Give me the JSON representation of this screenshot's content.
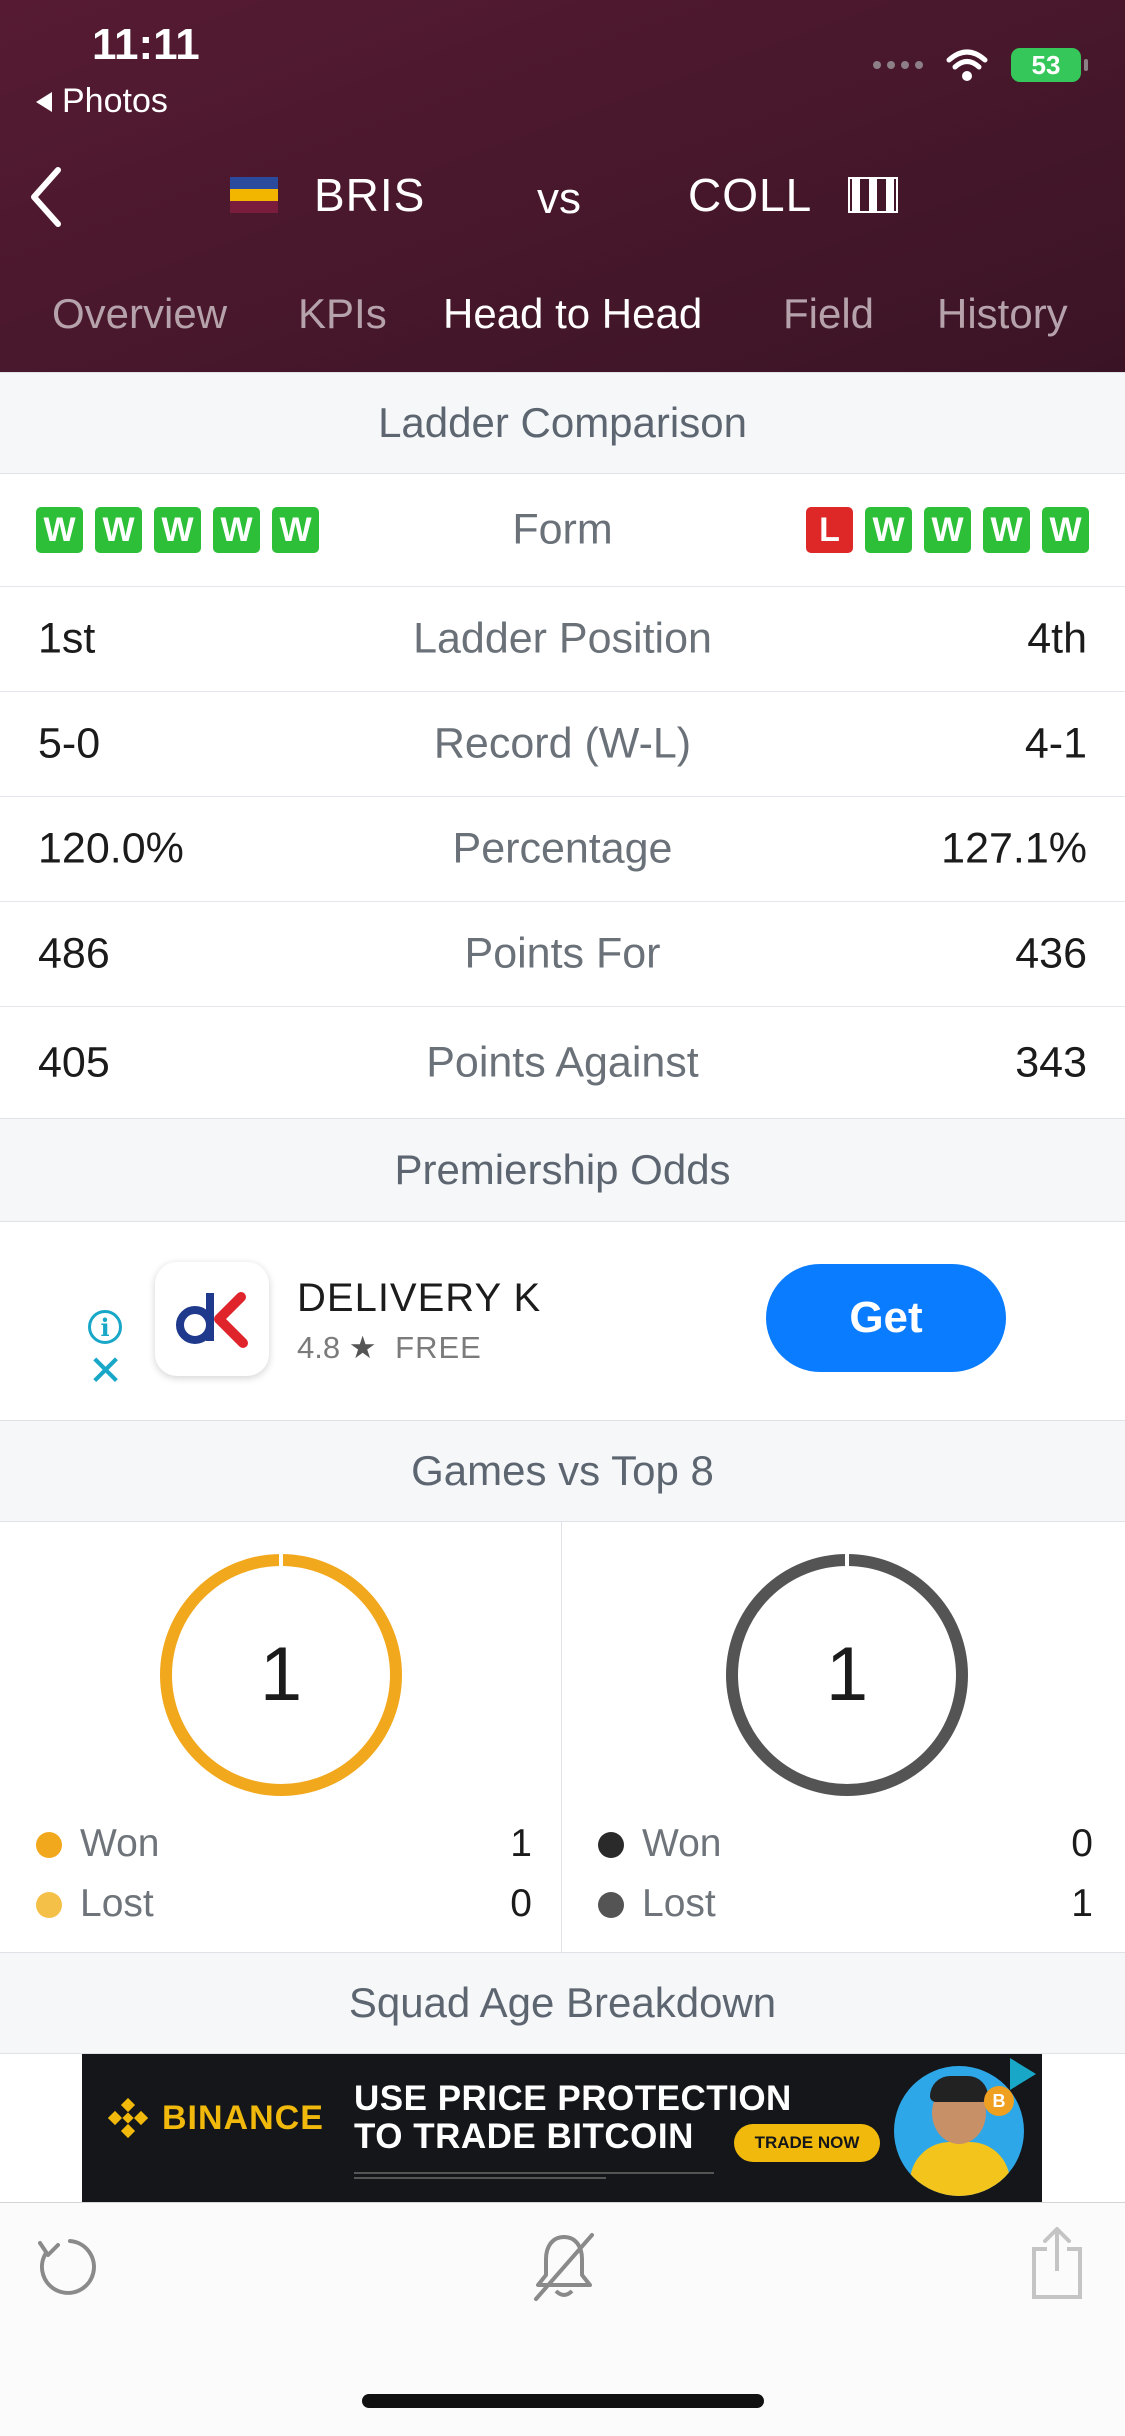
{
  "status_bar": {
    "time": "11:11",
    "back_label": "Photos",
    "battery": "53"
  },
  "match": {
    "home_team": "BRIS",
    "away_team": "COLL",
    "vs": "vs"
  },
  "tabs": [
    {
      "label": "Overview",
      "active": false
    },
    {
      "label": "KPIs",
      "active": false
    },
    {
      "label": "Head to Head",
      "active": true
    },
    {
      "label": "Field",
      "active": false
    },
    {
      "label": "History",
      "active": false
    }
  ],
  "ladder": {
    "title": "Ladder Comparison",
    "form_label": "Form",
    "form_left": [
      "W",
      "W",
      "W",
      "W",
      "W"
    ],
    "form_right": [
      "L",
      "W",
      "W",
      "W",
      "W"
    ],
    "rows": [
      {
        "left": "1st",
        "label": "Ladder Position",
        "right": "4th"
      },
      {
        "left": "5-0",
        "label": "Record (W-L)",
        "right": "4-1"
      },
      {
        "left": "120.0%",
        "label": "Percentage",
        "right": "127.1%"
      },
      {
        "left": "486",
        "label": "Points For",
        "right": "436"
      },
      {
        "left": "405",
        "label": "Points Against",
        "right": "343"
      }
    ]
  },
  "premiership_odds": {
    "title": "Premiership Odds"
  },
  "ad": {
    "app_icon_text": "dK",
    "app_name": "DELIVERY K",
    "rating": "4.8",
    "star": "★",
    "price": "FREE",
    "button_label": "Get",
    "info_icon": "i",
    "close_icon": "✕"
  },
  "games_vs_top8": {
    "title": "Games vs Top 8",
    "home": {
      "total": "1",
      "won_label": "Won",
      "won": "1",
      "lost_label": "Lost",
      "lost": "0",
      "color": "#f2a81d",
      "lost_color": "#f4c048"
    },
    "away": {
      "total": "1",
      "won_label": "Won",
      "won": "0",
      "lost_label": "Lost",
      "lost": "1",
      "color": "#545454",
      "lost_color": "#545454",
      "won_color": "#2a2a2a"
    }
  },
  "squad_age": {
    "title": "Squad Age Breakdown"
  },
  "banner": {
    "brand": "BINANCE",
    "line1": "USE PRICE PROTECTION",
    "line2": "TO TRADE BITCOIN",
    "cta": "TRADE NOW",
    "coin": "B"
  },
  "toolbar": {
    "refresh": "refresh-icon",
    "notify": "bell-slash-icon",
    "share": "share-icon"
  },
  "colors": {
    "header_bg": "#4d1930",
    "win": "#2dbf38",
    "loss": "#de2727",
    "accent_blue": "#0a7cff"
  }
}
